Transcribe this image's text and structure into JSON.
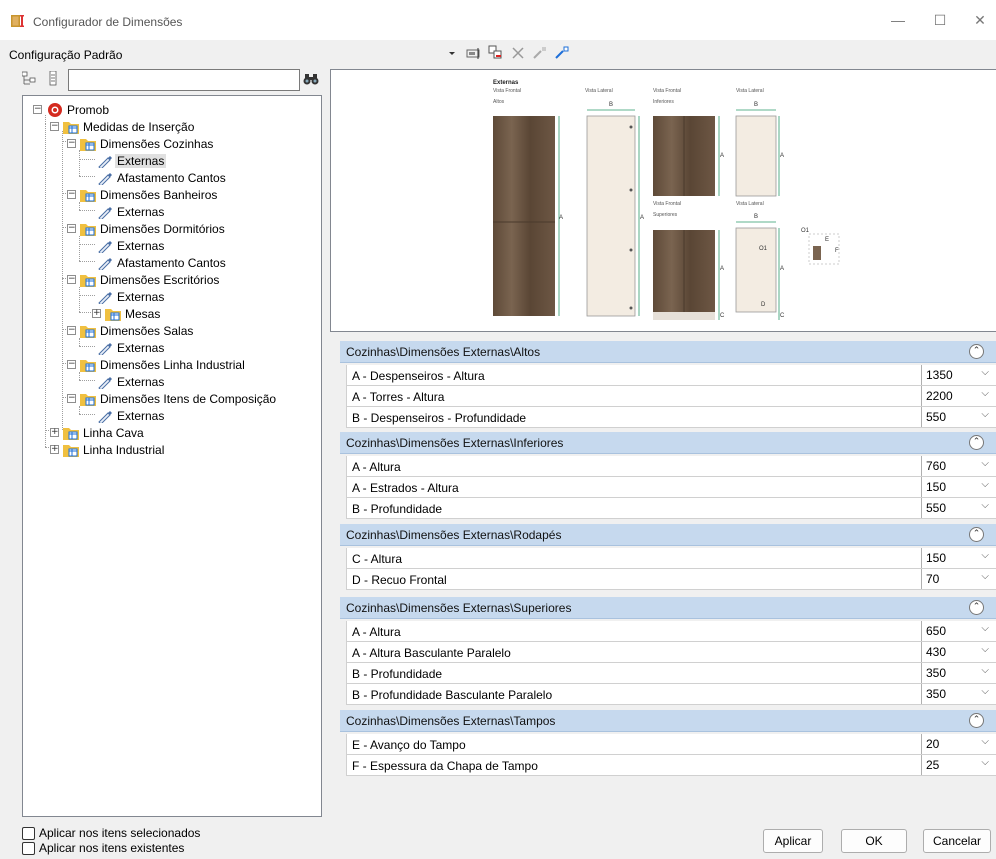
{
  "window": {
    "title": "Configurador de Dimensões",
    "minimize": "—",
    "maximize": "☐",
    "close": "✕"
  },
  "config_label": "Configuração Padrão",
  "search": {
    "value": "",
    "placeholder": ""
  },
  "tree": {
    "root": "Promob",
    "medidas": "Medidas de Inserção",
    "cozinhas": "Dimensões Cozinhas",
    "cozinhas_externas": "Externas",
    "cozinhas_afastamento": "Afastamento Cantos",
    "banheiros": "Dimensões Banheiros",
    "banheiros_externas": "Externas",
    "dormitorios": "Dimensões Dormitórios",
    "dormitorios_externas": "Externas",
    "dormitorios_afastamento": "Afastamento Cantos",
    "escritorios": "Dimensões Escritórios",
    "escritorios_externas": "Externas",
    "escritorios_mesas": "Mesas",
    "salas": "Dimensões Salas",
    "salas_externas": "Externas",
    "linha_industrial": "Dimensões Linha Industrial",
    "linha_industrial_externas": "Externas",
    "itens_composicao": "Dimensões Itens de Composição",
    "itens_composicao_externas": "Externas",
    "linha_cava": "Linha Cava",
    "linha_industrial2": "Linha Industrial"
  },
  "preview": {
    "title": "Externas",
    "vista_frontal": "Vista Frontal",
    "vista_lateral": "Vista Lateral",
    "altos": "Altos",
    "inferiores": "Inferiores",
    "superiores": "Superiores",
    "letters": {
      "a": "A",
      "b": "B",
      "c": "C",
      "d": "D",
      "e": "E",
      "f": "F",
      "o1": "O1"
    }
  },
  "groups": [
    {
      "header": "Cozinhas\\Dimensões Externas\\Altos",
      "rows": [
        {
          "name": "A - Despenseiros - Altura",
          "value": "1350"
        },
        {
          "name": "A - Torres - Altura",
          "value": "2200"
        },
        {
          "name": "B - Despenseiros - Profundidade",
          "value": "550"
        }
      ]
    },
    {
      "header": "Cozinhas\\Dimensões Externas\\Inferiores",
      "rows": [
        {
          "name": "A - Altura",
          "value": "760"
        },
        {
          "name": "A - Estrados - Altura",
          "value": "150"
        },
        {
          "name": "B - Profundidade",
          "value": "550"
        }
      ]
    },
    {
      "header": "Cozinhas\\Dimensões Externas\\Rodapés",
      "rows": [
        {
          "name": "C - Altura",
          "value": "150"
        },
        {
          "name": "D - Recuo Frontal",
          "value": "70"
        }
      ]
    },
    {
      "header": "Cozinhas\\Dimensões Externas\\Superiores",
      "rows": [
        {
          "name": "A - Altura",
          "value": "650"
        },
        {
          "name": "A - Altura Basculante Paralelo",
          "value": "430"
        },
        {
          "name": "B - Profundidade",
          "value": "350"
        },
        {
          "name": "B - Profundidade Basculante Paralelo",
          "value": "350"
        }
      ]
    },
    {
      "header": "Cozinhas\\Dimensões Externas\\Tampos",
      "rows": [
        {
          "name": "E -  Avanço do Tampo",
          "value": "20"
        },
        {
          "name": "F - Espessura da Chapa de Tampo",
          "value": "25"
        }
      ]
    }
  ],
  "checkboxes": {
    "selecionados": "Aplicar nos itens selecionados",
    "existentes": "Aplicar nos itens existentes"
  },
  "buttons": {
    "aplicar": "Aplicar",
    "ok": "OK",
    "cancelar": "Cancelar"
  },
  "colors": {
    "group_header": "#c6d9ee",
    "folder": "#f0c040",
    "accent": "#1e6fd9"
  }
}
